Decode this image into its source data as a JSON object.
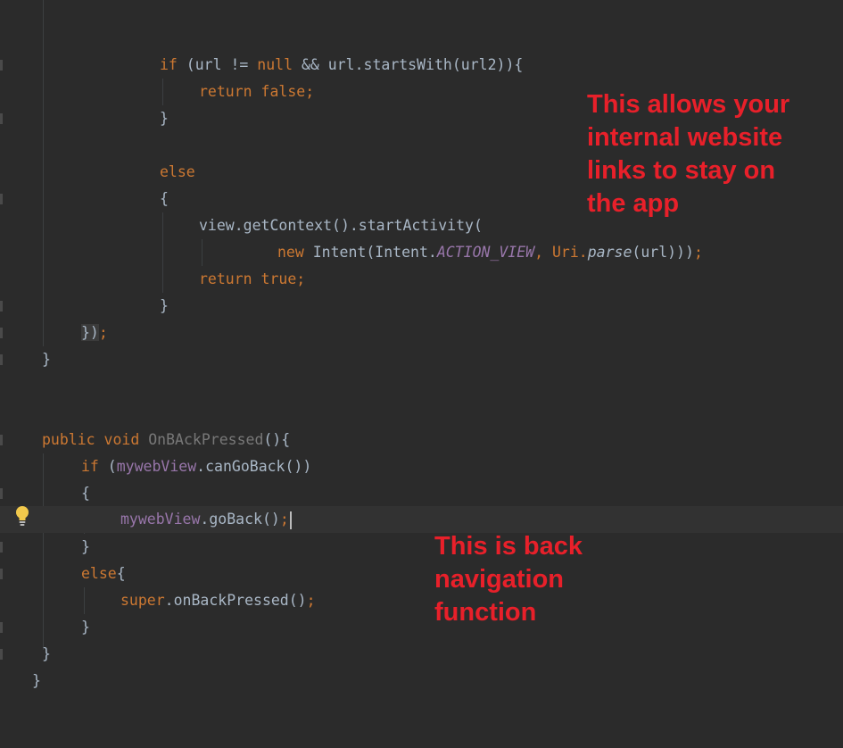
{
  "editor": {
    "lines": {
      "l1": [
        "if",
        " (url ",
        "!=",
        " ",
        "null",
        " && url.startsWith(url2)){"
      ],
      "l2": [
        "return",
        " ",
        "false",
        ";"
      ],
      "l3": "}",
      "l4": "else",
      "l5": "{",
      "l6": "view.getContext().startActivity(",
      "l7": [
        "new",
        " Intent(Intent.",
        "ACTION_VIEW",
        ", Uri.",
        "parse",
        "(url)))",
        ";"
      ],
      "l8": [
        "return",
        " ",
        "true",
        ";"
      ],
      "l9": "}",
      "l10": [
        "})",
        ";"
      ],
      "l11": "}",
      "l12": [
        "public",
        " ",
        "void",
        " ",
        "OnBAckPressed",
        "(){"
      ],
      "l13": [
        "if",
        " (",
        "mywebView",
        ".canGoBack())"
      ],
      "l14": "{",
      "l15": [
        "mywebView",
        ".goBack()",
        ";"
      ],
      "l16": "}",
      "l17": [
        "else",
        "{"
      ],
      "l18": [
        "super",
        ".onBackPressed()",
        ";"
      ],
      "l19": "}",
      "l20": "}",
      "l21": "}"
    },
    "intention_icon": "lightbulb-icon"
  },
  "annotations": {
    "note_top": "This allows your\ninternal website\nlinks to stay on\nthe app",
    "note_bottom": "This is back\nnavigation\nfunction"
  },
  "colors": {
    "background": "#2b2b2b",
    "keyword": "#cc7832",
    "field": "#9876aa",
    "text": "#a9b7c6",
    "annotation": "#e8202a"
  }
}
